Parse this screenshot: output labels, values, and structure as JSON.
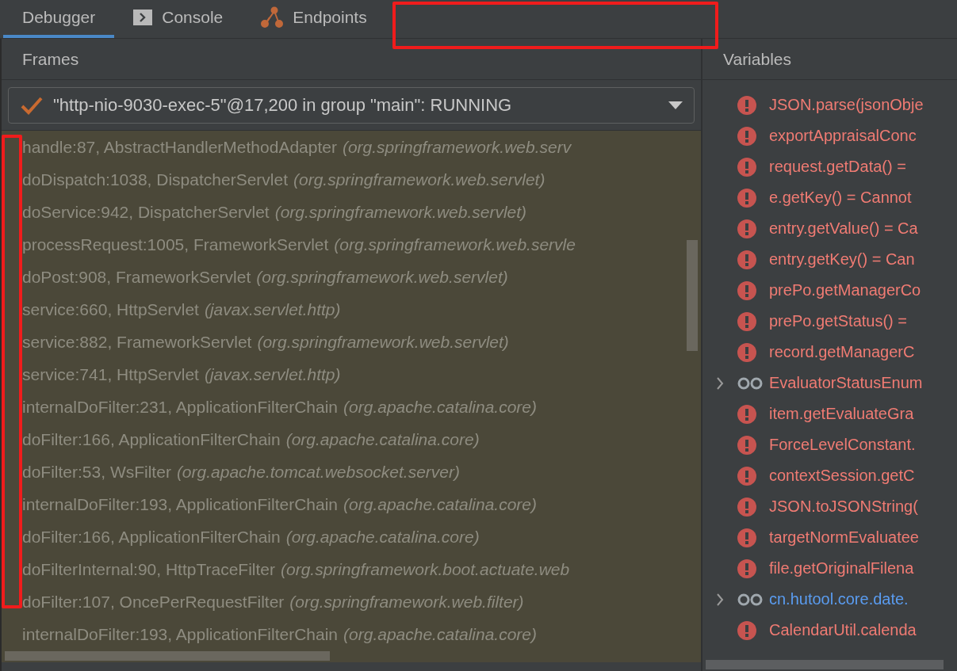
{
  "tabs": [
    {
      "label": "Debugger",
      "selected": true
    },
    {
      "label": "Console",
      "selected": false
    },
    {
      "label": "Endpoints",
      "selected": false
    }
  ],
  "frames": {
    "title": "Frames",
    "thread": "\"http-nio-9030-exec-5\"@17,200 in group \"main\": RUNNING",
    "rows": [
      {
        "method": "handle:87, AbstractHandlerMethodAdapter",
        "package": "(org.springframework.web.serv"
      },
      {
        "method": "doDispatch:1038, DispatcherServlet",
        "package": "(org.springframework.web.servlet)"
      },
      {
        "method": "doService:942, DispatcherServlet",
        "package": "(org.springframework.web.servlet)"
      },
      {
        "method": "processRequest:1005, FrameworkServlet",
        "package": "(org.springframework.web.servle"
      },
      {
        "method": "doPost:908, FrameworkServlet",
        "package": "(org.springframework.web.servlet)"
      },
      {
        "method": "service:660, HttpServlet",
        "package": "(javax.servlet.http)"
      },
      {
        "method": "service:882, FrameworkServlet",
        "package": "(org.springframework.web.servlet)"
      },
      {
        "method": "service:741, HttpServlet",
        "package": "(javax.servlet.http)"
      },
      {
        "method": "internalDoFilter:231, ApplicationFilterChain",
        "package": "(org.apache.catalina.core)"
      },
      {
        "method": "doFilter:166, ApplicationFilterChain",
        "package": "(org.apache.catalina.core)"
      },
      {
        "method": "doFilter:53, WsFilter",
        "package": "(org.apache.tomcat.websocket.server)"
      },
      {
        "method": "internalDoFilter:193, ApplicationFilterChain",
        "package": "(org.apache.catalina.core)"
      },
      {
        "method": "doFilter:166, ApplicationFilterChain",
        "package": "(org.apache.catalina.core)"
      },
      {
        "method": "doFilterInternal:90, HttpTraceFilter",
        "package": "(org.springframework.boot.actuate.web"
      },
      {
        "method": "doFilter:107, OncePerRequestFilter",
        "package": "(org.springframework.web.filter)"
      },
      {
        "method": "internalDoFilter:193, ApplicationFilterChain",
        "package": "(org.apache.catalina.core)"
      }
    ]
  },
  "variables": {
    "title": "Variables",
    "items": [
      {
        "kind": "error",
        "text": "JSON.parse(jsonObje",
        "color": "#f07b73"
      },
      {
        "kind": "error",
        "text": "exportAppraisalConc",
        "color": "#f07b73"
      },
      {
        "kind": "error",
        "text": "request.getData() =",
        "color": "#f07b73"
      },
      {
        "kind": "error",
        "text": "e.getKey() = Cannot",
        "color": "#f07b73"
      },
      {
        "kind": "error",
        "text": "entry.getValue() = Ca",
        "color": "#f07b73"
      },
      {
        "kind": "error",
        "text": "entry.getKey() = Can",
        "color": "#f07b73"
      },
      {
        "kind": "error",
        "text": "prePo.getManagerCo",
        "color": "#f07b73"
      },
      {
        "kind": "error",
        "text": "prePo.getStatus() =",
        "color": "#f07b73"
      },
      {
        "kind": "error",
        "text": "record.getManagerC",
        "color": "#f07b73"
      },
      {
        "kind": "watch",
        "text": "EvaluatorStatusEnum",
        "color": "#f07b73",
        "expanded": false
      },
      {
        "kind": "error",
        "text": "item.getEvaluateGra",
        "color": "#f07b73"
      },
      {
        "kind": "error",
        "text": "ForceLevelConstant.",
        "color": "#f07b73"
      },
      {
        "kind": "error",
        "text": "contextSession.getC",
        "color": "#f07b73"
      },
      {
        "kind": "error",
        "text": "JSON.toJSONString(",
        "color": "#f07b73"
      },
      {
        "kind": "error",
        "text": "targetNormEvaluatee",
        "color": "#f07b73"
      },
      {
        "kind": "error",
        "text": "file.getOriginalFilena",
        "color": "#f07b73"
      },
      {
        "kind": "watch",
        "text": "cn.hutool.core.date.",
        "color": "#5a9cf0",
        "expanded": false
      },
      {
        "kind": "error",
        "text": "CalendarUtil.calenda",
        "color": "#f07b73"
      }
    ]
  }
}
